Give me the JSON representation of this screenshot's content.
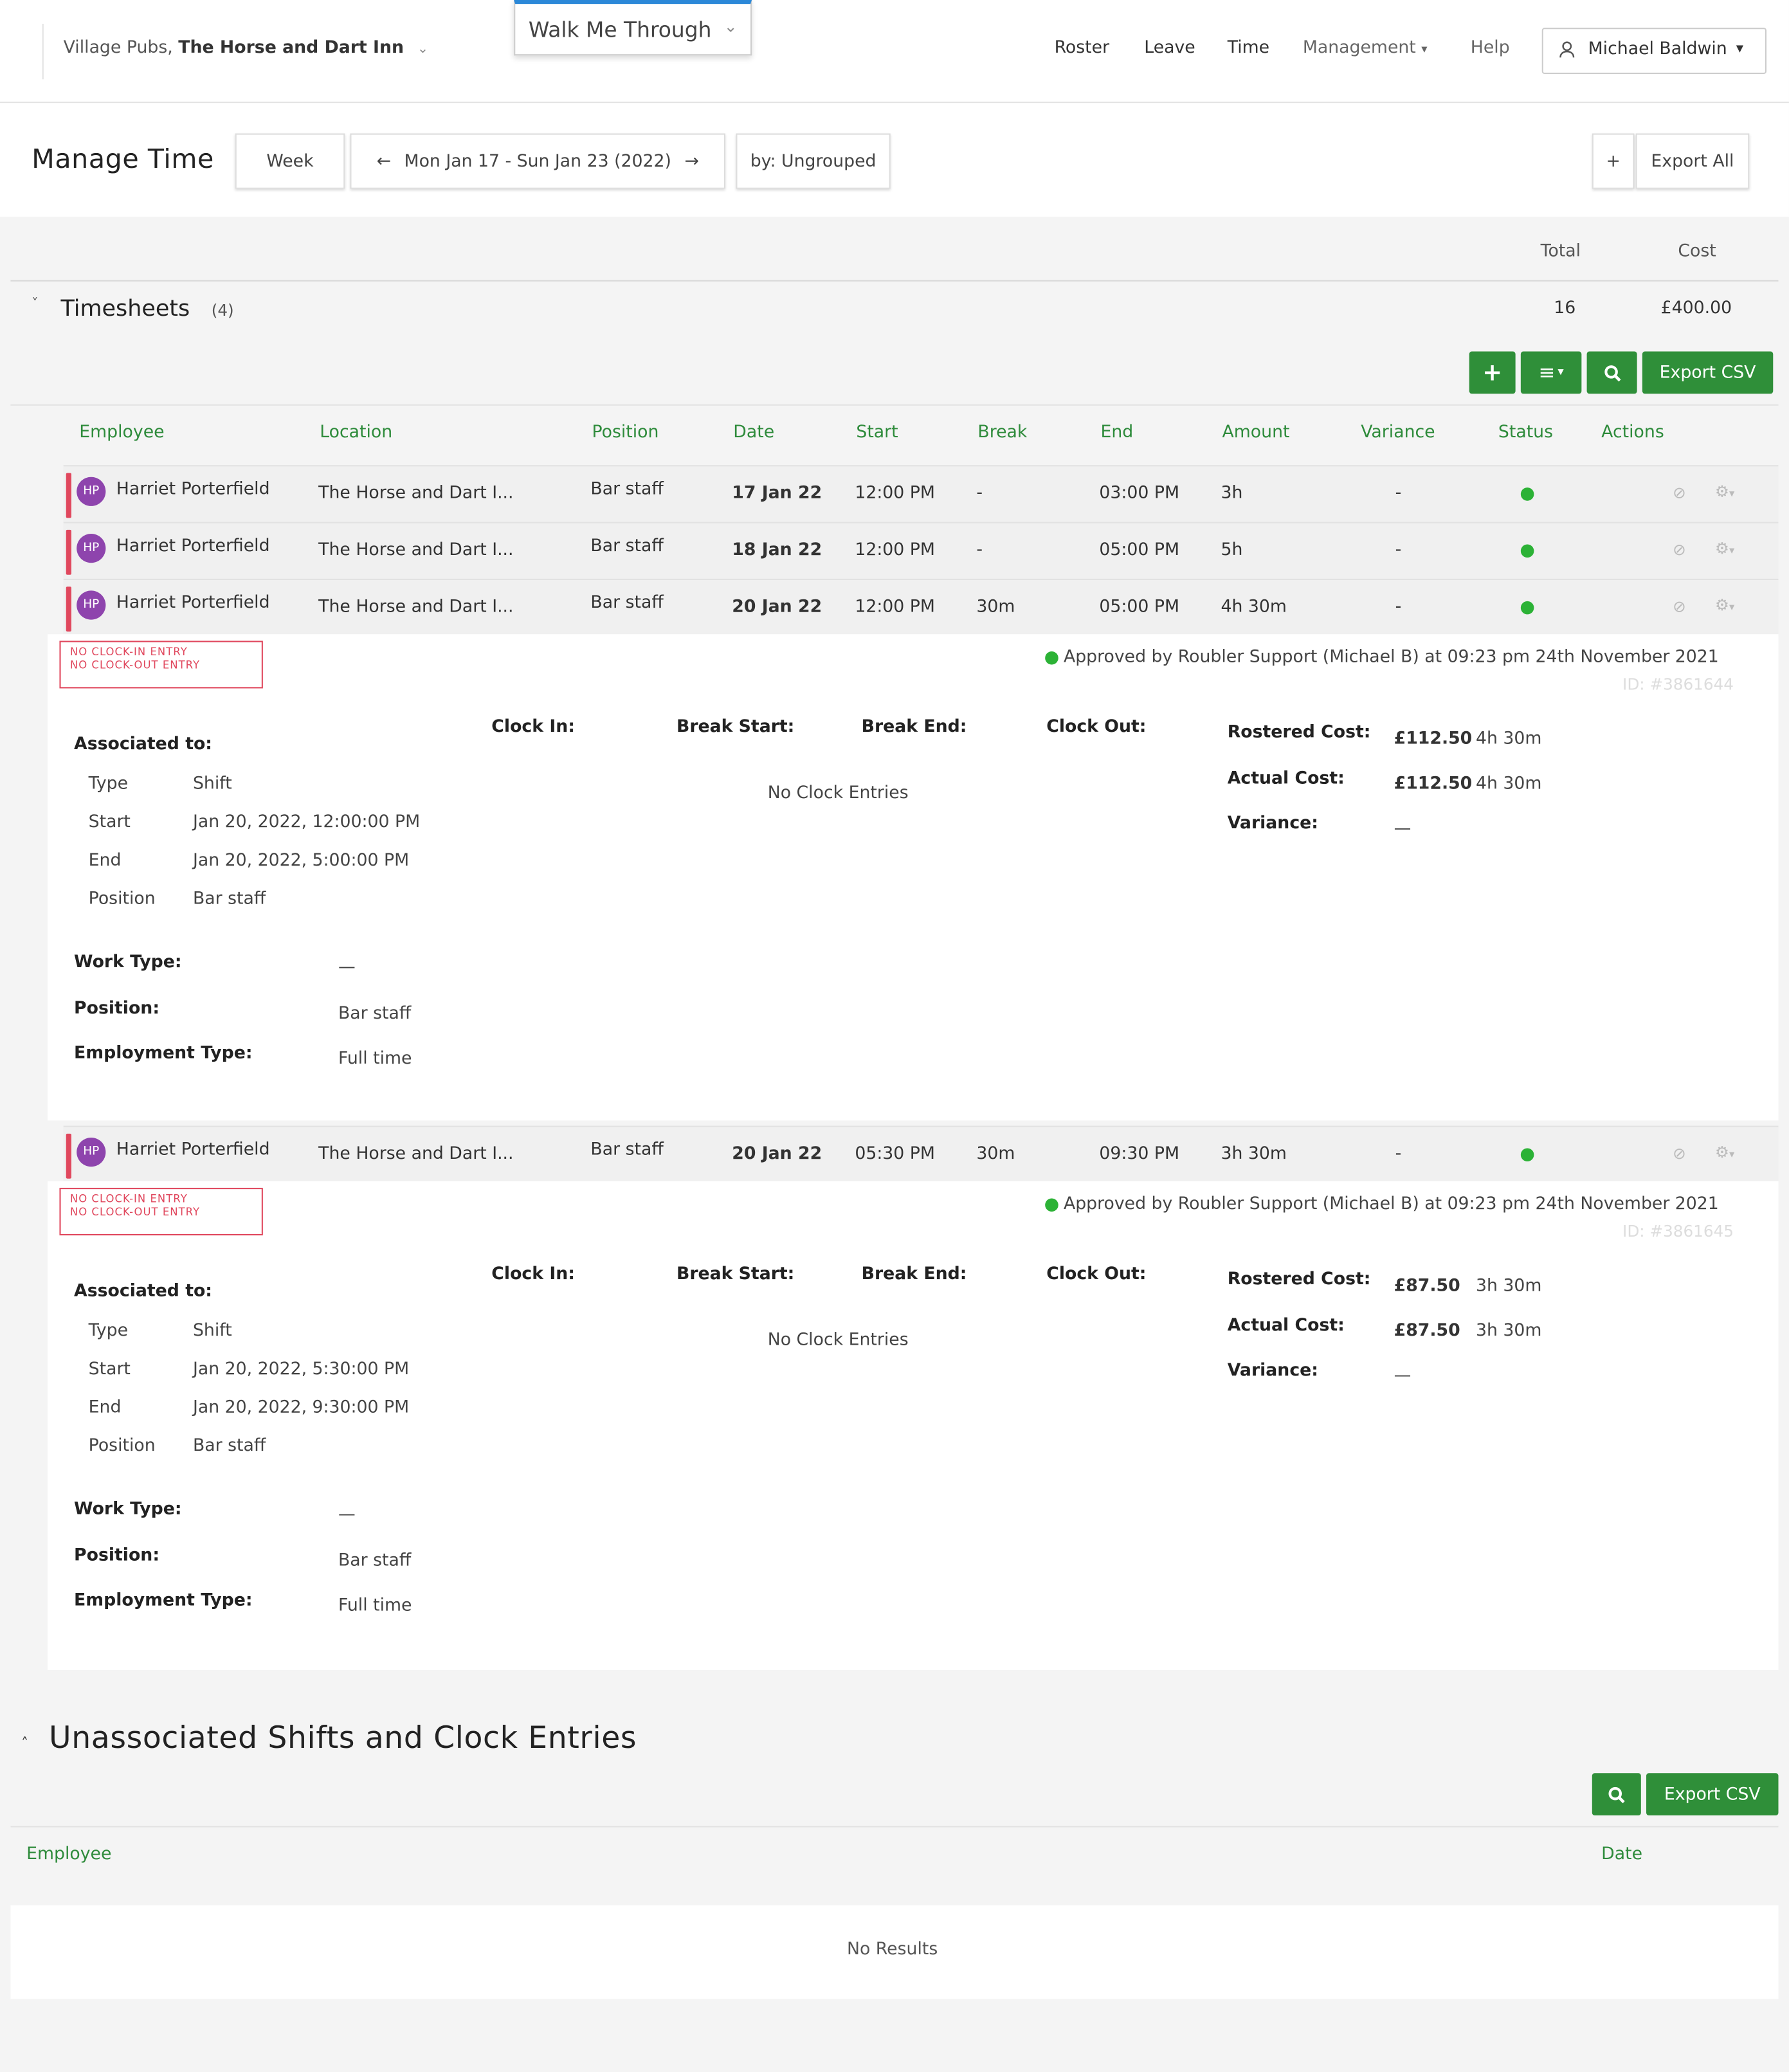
{
  "header": {
    "org_prefix": "Village Pubs,",
    "org_name": "The Horse and Dart Inn",
    "walk_me": "Walk Me Through",
    "nav": [
      "Roster",
      "Leave",
      "Time",
      "Management",
      "Help"
    ],
    "user": "Michael Baldwin"
  },
  "toolbar": {
    "title": "Manage Time",
    "week": "Week",
    "date_range": "Mon Jan 17 - Sun Jan 23 (2022)",
    "group": "by: Ungrouped",
    "plus": "+",
    "export_all": "Export All"
  },
  "summary": {
    "total_label": "Total",
    "cost_label": "Cost",
    "section": "Timesheets",
    "count": "(4)",
    "total": "16",
    "cost": "£400.00",
    "export_csv": "Export CSV"
  },
  "columns": [
    "Employee",
    "Location",
    "Position",
    "Date",
    "Start",
    "Break",
    "End",
    "Amount",
    "Variance",
    "Status",
    "Actions"
  ],
  "rows": [
    {
      "initials": "HP",
      "employee": "Harriet Porterfield",
      "location": "The Horse and Dart I...",
      "position": "Bar staff",
      "date": "17 Jan 22",
      "start": "12:00 PM",
      "break": "-",
      "end": "03:00 PM",
      "amount": "3h",
      "variance": "-"
    },
    {
      "initials": "HP",
      "employee": "Harriet Porterfield",
      "location": "The Horse and Dart I...",
      "position": "Bar staff",
      "date": "18 Jan 22",
      "start": "12:00 PM",
      "break": "-",
      "end": "05:00 PM",
      "amount": "5h",
      "variance": "-"
    },
    {
      "initials": "HP",
      "employee": "Harriet Porterfield",
      "location": "The Horse and Dart I...",
      "position": "Bar staff",
      "date": "20 Jan 22",
      "start": "12:00 PM",
      "break": "30m",
      "end": "05:00 PM",
      "amount": "4h 30m",
      "variance": "-"
    },
    {
      "initials": "HP",
      "employee": "Harriet Porterfield",
      "location": "The Horse and Dart I...",
      "position": "Bar staff",
      "date": "20 Jan 22",
      "start": "05:30 PM",
      "break": "30m",
      "end": "09:30 PM",
      "amount": "3h 30m",
      "variance": "-"
    }
  ],
  "details": [
    {
      "warn1": "NO CLOCK-IN ENTRY",
      "warn2": "NO CLOCK-OUT ENTRY",
      "approved": "Approved by Roubler Support (Michael B) at 09:23 pm 24th November 2021",
      "id": "ID: #3861644",
      "assoc_label": "Associated to:",
      "type_l": "Type",
      "type_v": "Shift",
      "start_l": "Start",
      "start_v": "Jan 20, 2022, 12:00:00 PM",
      "end_l": "End",
      "end_v": "Jan 20, 2022, 5:00:00 PM",
      "pos_l": "Position",
      "pos_v": "Bar staff",
      "clock_in": "Clock In:",
      "break_start": "Break Start:",
      "break_end": "Break End:",
      "clock_out": "Clock Out:",
      "no_clock": "No Clock Entries",
      "rostered_l": "Rostered Cost:",
      "rostered_v": "£112.50",
      "rostered_h": "4h 30m",
      "actual_l": "Actual Cost:",
      "actual_v": "£112.50",
      "actual_h": "4h 30m",
      "variance_l": "Variance:",
      "variance_v": "—",
      "work_type_l": "Work Type:",
      "work_type_v": "—",
      "position_l": "Position:",
      "position_v": "Bar staff",
      "emp_type_l": "Employment Type:",
      "emp_type_v": "Full time"
    },
    {
      "warn1": "NO CLOCK-IN ENTRY",
      "warn2": "NO CLOCK-OUT ENTRY",
      "approved": "Approved by Roubler Support (Michael B) at 09:23 pm 24th November 2021",
      "id": "ID: #3861645",
      "assoc_label": "Associated to:",
      "type_l": "Type",
      "type_v": "Shift",
      "start_l": "Start",
      "start_v": "Jan 20, 2022, 5:30:00 PM",
      "end_l": "End",
      "end_v": "Jan 20, 2022, 9:30:00 PM",
      "pos_l": "Position",
      "pos_v": "Bar staff",
      "clock_in": "Clock In:",
      "break_start": "Break Start:",
      "break_end": "Break End:",
      "clock_out": "Clock Out:",
      "no_clock": "No Clock Entries",
      "rostered_l": "Rostered Cost:",
      "rostered_v": "£87.50",
      "rostered_h": "3h 30m",
      "actual_l": "Actual Cost:",
      "actual_v": "£87.50",
      "actual_h": "3h 30m",
      "variance_l": "Variance:",
      "variance_v": "—",
      "work_type_l": "Work Type:",
      "work_type_v": "—",
      "position_l": "Position:",
      "position_v": "Bar staff",
      "emp_type_l": "Employment Type:",
      "emp_type_v": "Full time"
    }
  ],
  "unassociated": {
    "title": "Unassociated Shifts and Clock Entries",
    "export_csv": "Export CSV",
    "col_employee": "Employee",
    "col_date": "Date",
    "empty": "No Results"
  },
  "colors": {
    "accent": "#2f8f39",
    "warning": "#e0475d",
    "status_ok": "#2cb236",
    "avatar": "#8e44ad"
  },
  "icons": [
    "user-icon",
    "chevron-down-icon",
    "arrow-left-icon",
    "arrow-right-icon",
    "plus-icon",
    "list-icon",
    "search-icon",
    "check-circle-icon",
    "gear-icon",
    "caret-up-icon"
  ]
}
